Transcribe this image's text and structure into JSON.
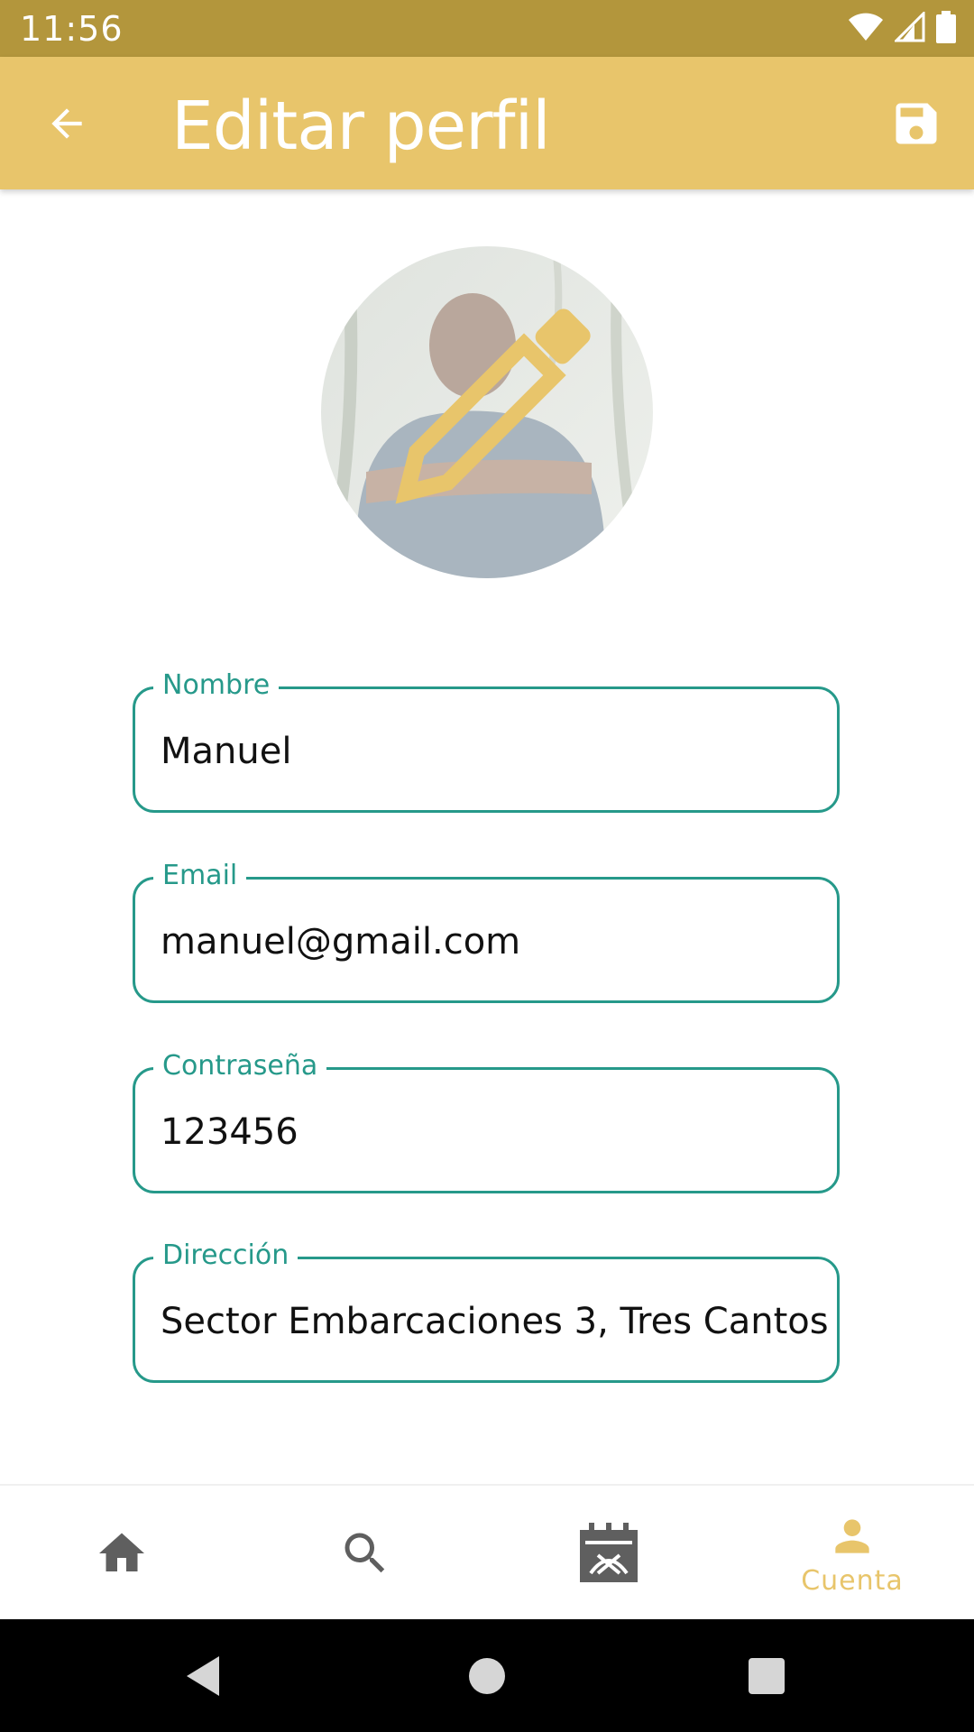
{
  "status_bar": {
    "time": "11:56",
    "icons": [
      "wifi-icon",
      "cell-signal-icon",
      "battery-icon"
    ]
  },
  "app_bar": {
    "title": "Editar perfil",
    "back_icon": "arrow-back-icon",
    "save_icon": "save-floppy-icon"
  },
  "avatar": {
    "overlay_icon": "pencil-edit-icon"
  },
  "form": {
    "fields": [
      {
        "label": "Nombre",
        "value": "Manuel"
      },
      {
        "label": "Email",
        "value": "manuel@gmail.com"
      },
      {
        "label": "Contraseña",
        "value": "123456"
      },
      {
        "label": "Dirección",
        "value": "Sector Embarcaciones 3, Tres Cantos"
      }
    ]
  },
  "bottom_nav": {
    "items": [
      {
        "icon": "home-icon",
        "label": ""
      },
      {
        "icon": "search-icon",
        "label": ""
      },
      {
        "icon": "calendar-icon",
        "label": ""
      },
      {
        "icon": "person-icon",
        "label": "Cuenta"
      }
    ],
    "active_index": 3
  },
  "colors": {
    "status_bar": "#b3963c",
    "app_bar": "#e8c56b",
    "accent": "#e8c56b",
    "field_outline": "#26998a",
    "nav_inactive": "#5f5f5f"
  }
}
